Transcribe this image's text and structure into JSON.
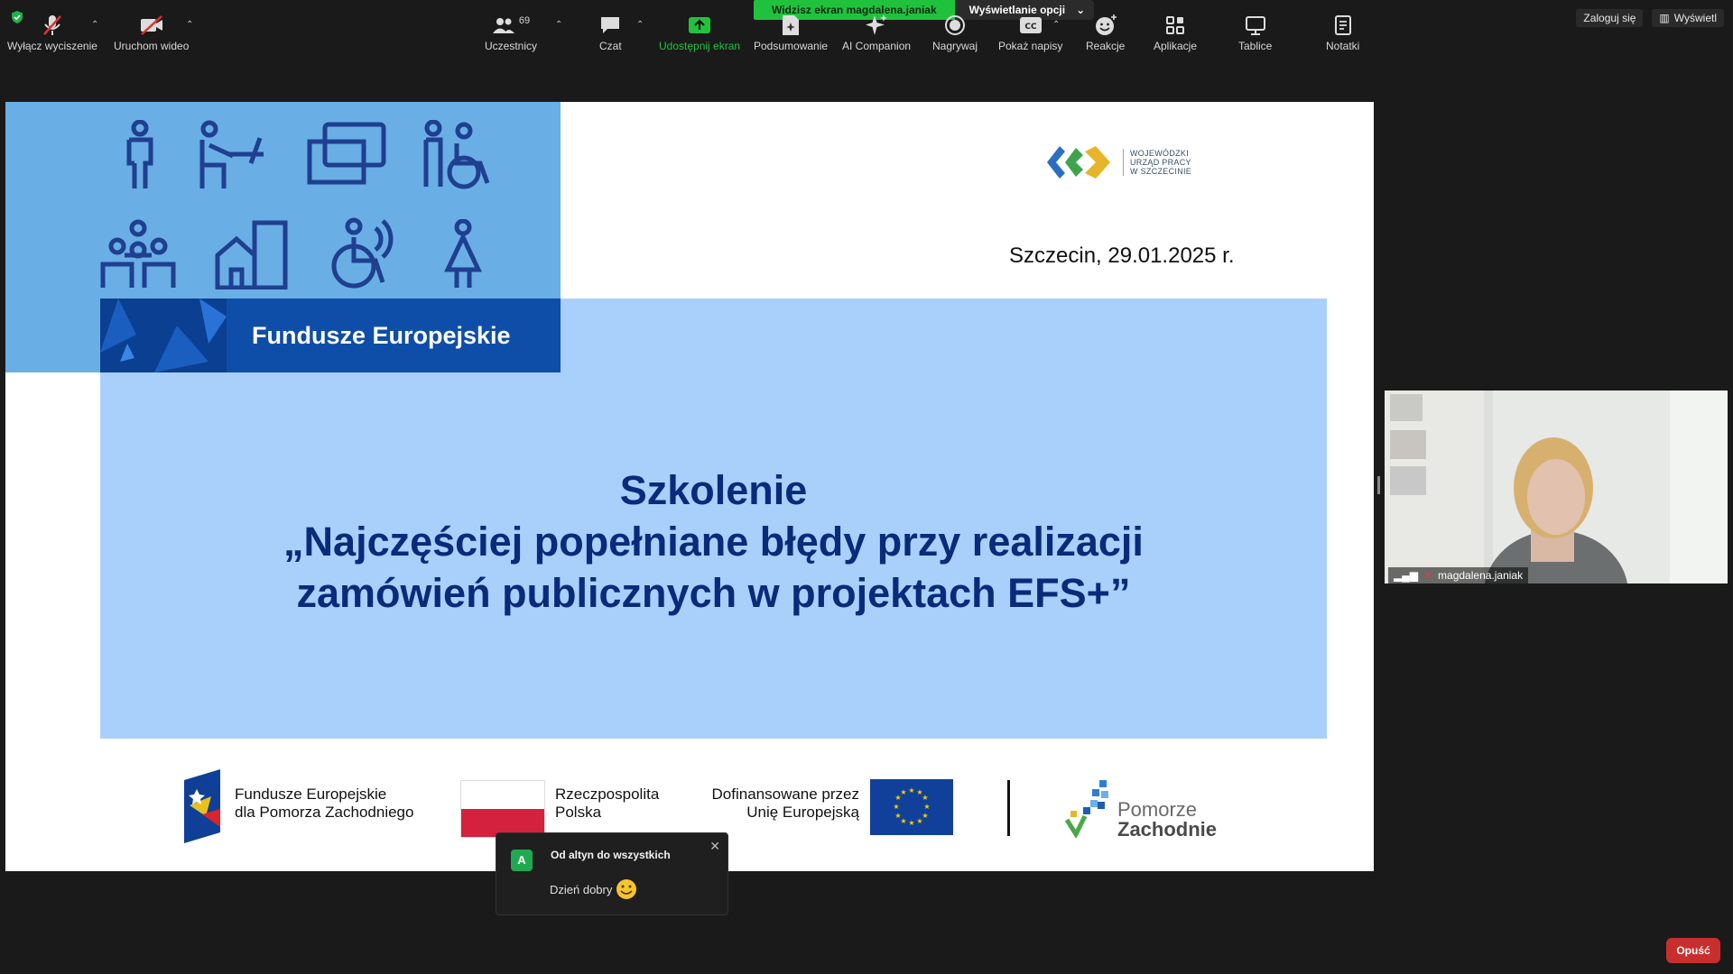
{
  "top": {
    "share_status": "Widzisz ekran magdalena.janiak",
    "view_options": "Wyświetlanie opcji",
    "signin": "Zaloguj się",
    "view": "Wyświetl"
  },
  "slide": {
    "fe_label": "Fundusze Europejskie",
    "wup_lines": [
      "WOJEWÓDZKI",
      "URZĄD PRACY",
      "W SZCZECINIE"
    ],
    "date": "Szczecin, 29.01.2025 r.",
    "title_lines": [
      "Szkolenie",
      "„Najczęściej popełniane błędy przy realizacji",
      "zamówień publicznych w projektach EFS+”"
    ],
    "logos": {
      "fe_pz_1": "Fundusze Europejskie",
      "fe_pz_2": "dla Pomorza Zachodniego",
      "rp_1": "Rzeczpospolita",
      "rp_2": "Polska",
      "eu_1": "Dofinansowane przez",
      "eu_2": "Unię Europejską",
      "pom_1": "Pomorze",
      "pom_2": "Zachodnie"
    }
  },
  "video": {
    "participant": "magdalena.janiak"
  },
  "chat": {
    "avatar": "A",
    "from": "Od altyn do wszystkich",
    "message": "Dzień dobry"
  },
  "toolbar": {
    "mute": "Wyłącz wyciszenie",
    "video": "Uruchom wideo",
    "participants": "Uczestnicy",
    "participants_count": "69",
    "chat": "Czat",
    "share": "Udostępnij ekran",
    "summary": "Podsumowanie",
    "ai": "AI Companion",
    "record": "Nagrywaj",
    "captions": "Pokaż napisy",
    "reactions": "Reakcje",
    "apps": "Aplikacje",
    "whiteboards": "Tablice",
    "notes": "Notatki",
    "leave": "Opuść"
  },
  "colors": {
    "share_green": "#20c23d",
    "slide_light_blue": "#a9d0fb",
    "fe_blue": "#0f4ea8",
    "title_navy": "#0a2a7a",
    "leave_red": "#c92e2e"
  }
}
